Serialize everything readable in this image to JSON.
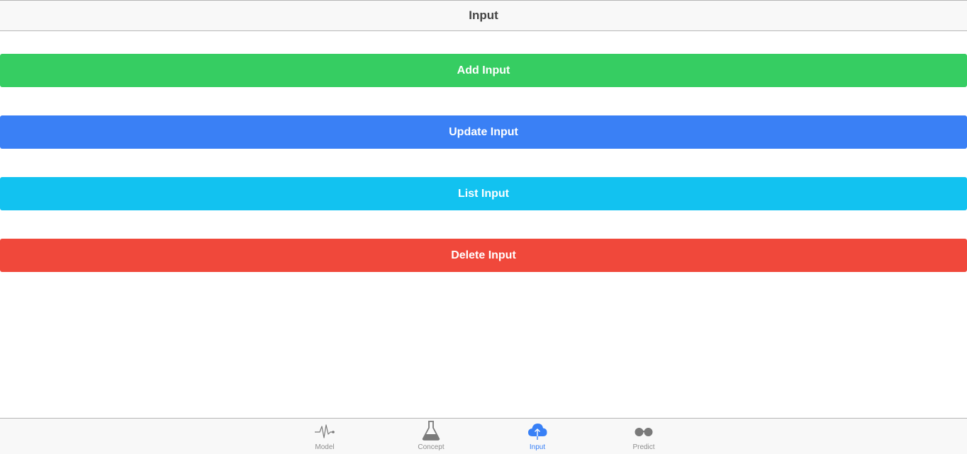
{
  "header": {
    "title": "Input"
  },
  "actions": {
    "add_label": "Add Input",
    "update_label": "Update Input",
    "list_label": "List Input",
    "delete_label": "Delete Input"
  },
  "colors": {
    "add": "#36cd62",
    "update": "#3a80f5",
    "list": "#12c2f0",
    "delete": "#f0483b",
    "active_tab": "#3880f6",
    "inactive_tab": "#8e8e8e"
  },
  "tabs": [
    {
      "label": "Model",
      "icon": "pulse-icon",
      "active": false
    },
    {
      "label": "Concept",
      "icon": "flask-icon",
      "active": false
    },
    {
      "label": "Input",
      "icon": "cloud-upload-icon",
      "active": true
    },
    {
      "label": "Predict",
      "icon": "glasses-icon",
      "active": false
    }
  ]
}
